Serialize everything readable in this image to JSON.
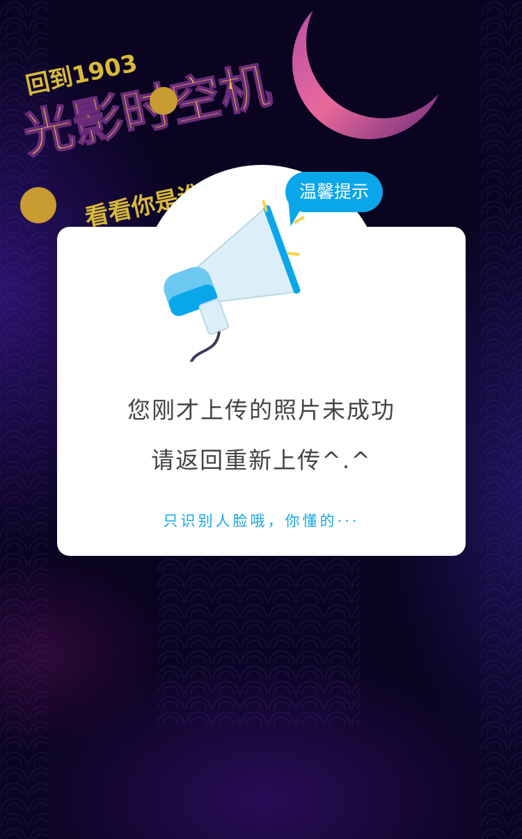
{
  "poster": {
    "title_line1": "回到1903",
    "title_line2": "光影时空机",
    "title_line3": "看看你是谁"
  },
  "dialog": {
    "badge": "温馨提示",
    "message_line1": "您刚才上传的照片未成功",
    "message_line2": "请返回重新上传^.^",
    "note": "只识别人脸哦，你懂的···"
  },
  "colors": {
    "background": "#0a0420",
    "accent": "#0aa6ea",
    "text": "#444444"
  },
  "icons": [
    "megaphone-icon",
    "moon-decoration",
    "wave-pattern"
  ]
}
